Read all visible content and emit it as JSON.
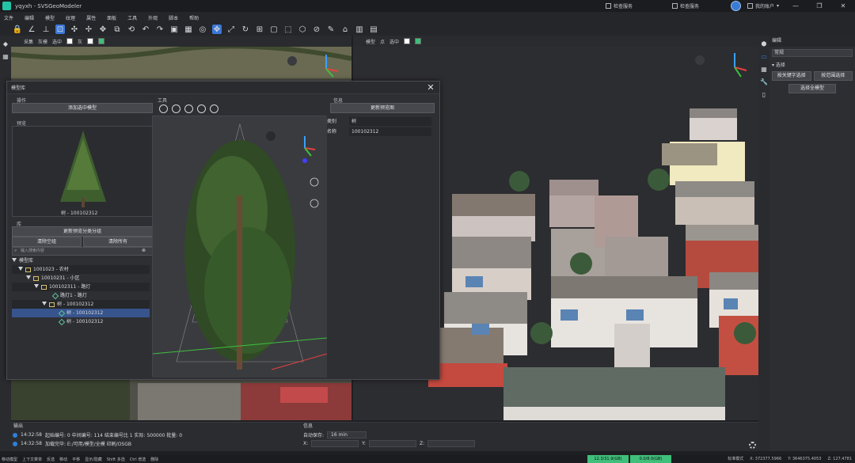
{
  "app": {
    "title": "yqyxh - SVSGeoModeler",
    "accent": "#23c3a6"
  },
  "titlebar": {
    "link1": "检查服务",
    "link2": "检查服务",
    "user_label": "我的账户"
  },
  "menu": [
    "文件",
    "编辑",
    "模型",
    "纹理",
    "属性",
    "面板",
    "工具",
    "外观",
    "脚本",
    "帮助"
  ],
  "viewport_left_header": {
    "label1": "采集",
    "label2": "灰模",
    "label3": "选中",
    "label4": "灰"
  },
  "viewport_right_header": {
    "label1": "模型",
    "label2": "点",
    "label3": "选中"
  },
  "dialog": {
    "title": "模型库",
    "ops_label": "操作",
    "tools_label": "工具",
    "info_label": "信息",
    "add_model_button": "添加选中模型",
    "preview_label": "预览",
    "preview_caption": "树 - 100102312",
    "lib_label": "库",
    "update_preview_button": "更新预览分类分组",
    "clear_empty_button": "清除空组",
    "clear_all_button": "清除所有",
    "search_placeholder": "输入搜索内容",
    "refresh_preview_button": "更新预览图",
    "info_rows": [
      {
        "key": "类别",
        "value": "树"
      },
      {
        "key": "名称",
        "value": "100102312"
      }
    ],
    "tree": [
      {
        "label": "模型库",
        "level": 0,
        "kind": "root"
      },
      {
        "label": "1001023 - 农村",
        "level": 1,
        "kind": "folder"
      },
      {
        "label": "10010231 - 小区",
        "level": 2,
        "kind": "folder"
      },
      {
        "label": "100102311 - 路灯",
        "level": 3,
        "kind": "folder"
      },
      {
        "label": "路灯1 - 路灯",
        "level": 4,
        "kind": "item"
      },
      {
        "label": "树 - 100102312",
        "level": 3,
        "kind": "folder"
      },
      {
        "label": "树 - 100102312",
        "level": 4,
        "kind": "item",
        "selected": true
      },
      {
        "label": "树 - 100102312",
        "level": 4,
        "kind": "item"
      }
    ]
  },
  "right_panel": {
    "title": "编辑",
    "select_value": "常规",
    "section": "选择",
    "btn_a": "按关键字选择",
    "btn_b": "按范围选择",
    "btn_c": "选择全模型"
  },
  "output": {
    "title": "输出",
    "logs": [
      {
        "time": "14:32:58",
        "text": "起始编号: 0  中间编号: 114  结束编号比 1  实际: 500000  批量: 0"
      },
      {
        "time": "14:32:58",
        "text": "加载完毕: E:/可用/模型/全模 印刷/OSGB"
      }
    ]
  },
  "info_panel": {
    "title": "信息",
    "autosave_label": "自动保存:",
    "autosave_value": "16 min",
    "x_label": "X:",
    "y_label": "Y:",
    "z_label": "Z:"
  },
  "statusbar": {
    "items": [
      "移动模型",
      "上下文菜单",
      "反选",
      "移动",
      "平移",
      "显示/隐藏",
      "Shift 多选",
      "Ctrl 增选",
      "删除"
    ],
    "mem1": "12.3/31.9(GB)",
    "mem2": "0.0/8.0(GB)",
    "mode": "标准模式",
    "x": "X: 372377.5966",
    "y": "Y: 3646375.4053",
    "z": "Z: 127.4781",
    "mem1_color": "#3fbf7a",
    "mem2_color": "#3fbf7a"
  }
}
